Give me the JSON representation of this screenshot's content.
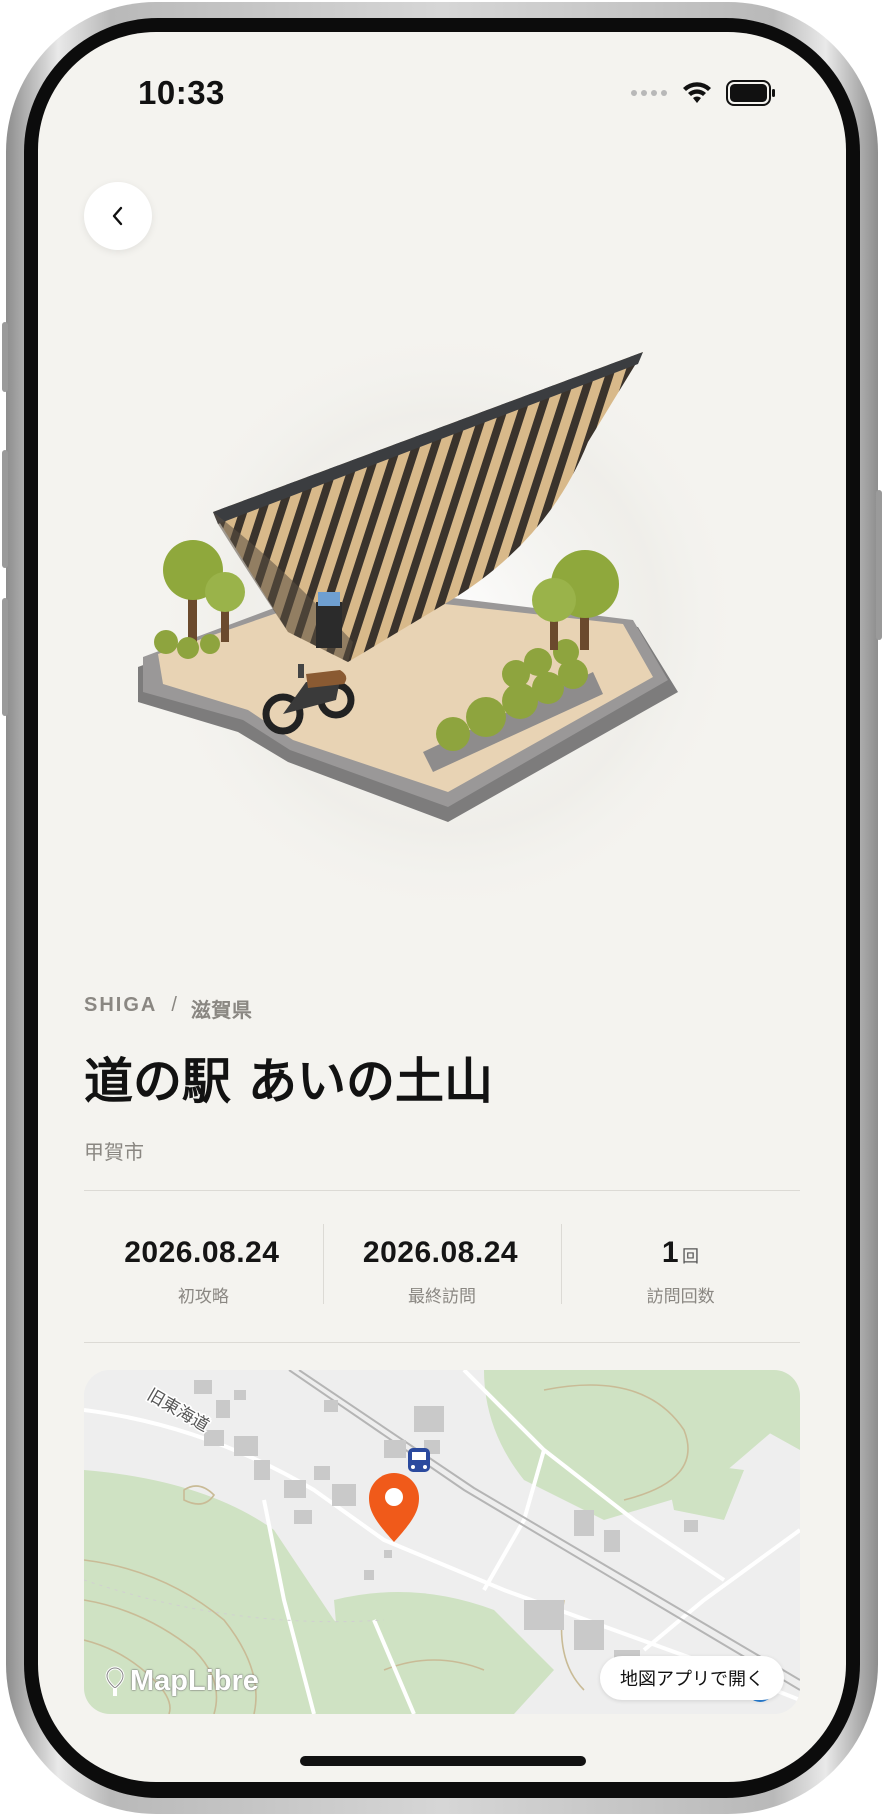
{
  "status_bar": {
    "time": "10:33"
  },
  "place": {
    "prefecture_en": "SHIGA",
    "separator": "/",
    "prefecture_ja": "滋賀県",
    "name": "道の駅 あいの土山",
    "city": "甲賀市"
  },
  "stats": [
    {
      "value": "2026.08.24",
      "unit": "",
      "label": "初攻略"
    },
    {
      "value": "2026.08.24",
      "unit": "",
      "label": "最終訪問"
    },
    {
      "value": "1",
      "unit": "回",
      "label": "訪問回数"
    }
  ],
  "map": {
    "road_label": "旧東海道",
    "attribution": "MapLibre",
    "open_button": "地図アプリで開く"
  },
  "colors": {
    "background": "#f4f3ef",
    "pin": "#f05a1a",
    "map_green": "#cfe2c3",
    "map_base": "#eeeeee"
  }
}
